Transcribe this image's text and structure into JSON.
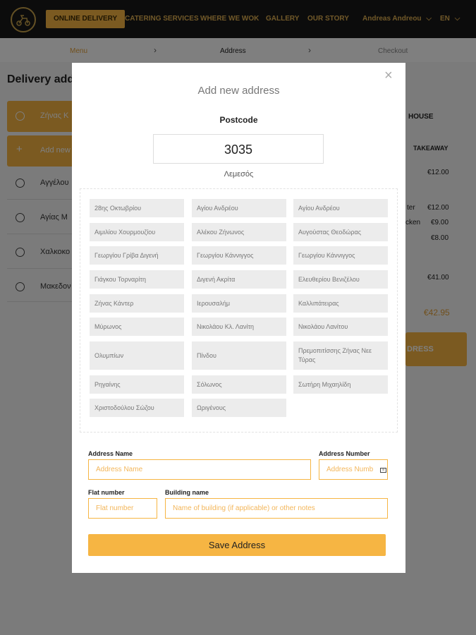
{
  "nav": {
    "items": [
      {
        "label": "ONLINE DELIVERY"
      },
      {
        "label": "CATERING SERVICES"
      },
      {
        "label": "WHERE WE WOK"
      },
      {
        "label": "GALLERY"
      },
      {
        "label": "OUR STORY"
      }
    ],
    "user": "Andreas Andreou",
    "lang": "EN"
  },
  "breadcrumb": {
    "steps": [
      "Menu",
      "Address",
      "Checkout"
    ]
  },
  "page": {
    "title": "Delivery add",
    "addresses": [
      {
        "label": "Ζήνας Κ"
      },
      {
        "label": "Add new"
      },
      {
        "label": "Αγγέλου"
      },
      {
        "label": "Αγίας Μ"
      },
      {
        "label": "Χαλκοκο"
      },
      {
        "label": "Μακεδον"
      }
    ],
    "right": {
      "house": "HOUSE",
      "takeaway": "TAKEAWAY",
      "price1": "€12.00",
      "item2": "ter",
      "price2": "€12.00",
      "item3": "cken",
      "price3": "€9.00",
      "price4": "€8.00",
      "subtotal": "€41.00",
      "total": "€42.95",
      "button": "DRESS"
    }
  },
  "modal": {
    "title": "Add new address",
    "postcode_label": "Postcode",
    "postcode_value": "3035",
    "city": "Λεμεσός",
    "streets": [
      "28ης Οκτωβρίου",
      "Αγίου Ανδρέου",
      "Αγίου Ανδρέου",
      "Αιμιλίου Χουρμουζίου",
      "Αλέκου Ζήνωνος",
      "Αυγούστας Θεοδώρας",
      "Γεωργίου Γρίβα Διγενή",
      "Γεωργίου Κάννιγγος",
      "Γεωργίου Κάννιγγος",
      "Γιάγκου Τορναρίτη",
      "Διγενή Ακρίτα",
      "Ελευθερίου Βενιζέλου",
      "Ζήνας Κάντερ",
      "Ιερουσαλήμ",
      "Καλλιπάτειρας",
      "Μύρωνος",
      "Νικολάου Κλ. Λανίτη",
      "Νικολάου Λανίτου",
      "Ολυμπίων",
      "Πίνδου",
      "Πρεμοπιτίσσης Ζήνας Νεε Τύρας",
      "Ρηγαίνης",
      "Σόλωνος",
      "Σωτήρη Μιχαηλίδη",
      "Χριστοδούλου Σώζου",
      "Ωριγένους"
    ],
    "address_name_label": "Address Name",
    "address_name_placeholder": "Address Name",
    "address_number_label": "Address Number",
    "address_number_placeholder": "Address Numb",
    "flat_label": "Flat number",
    "flat_placeholder": "Flat number",
    "building_label": "Building name",
    "building_placeholder": "Name of building (if applicable) or other notes",
    "save_label": "Save Address",
    "close_glyph": "×"
  }
}
